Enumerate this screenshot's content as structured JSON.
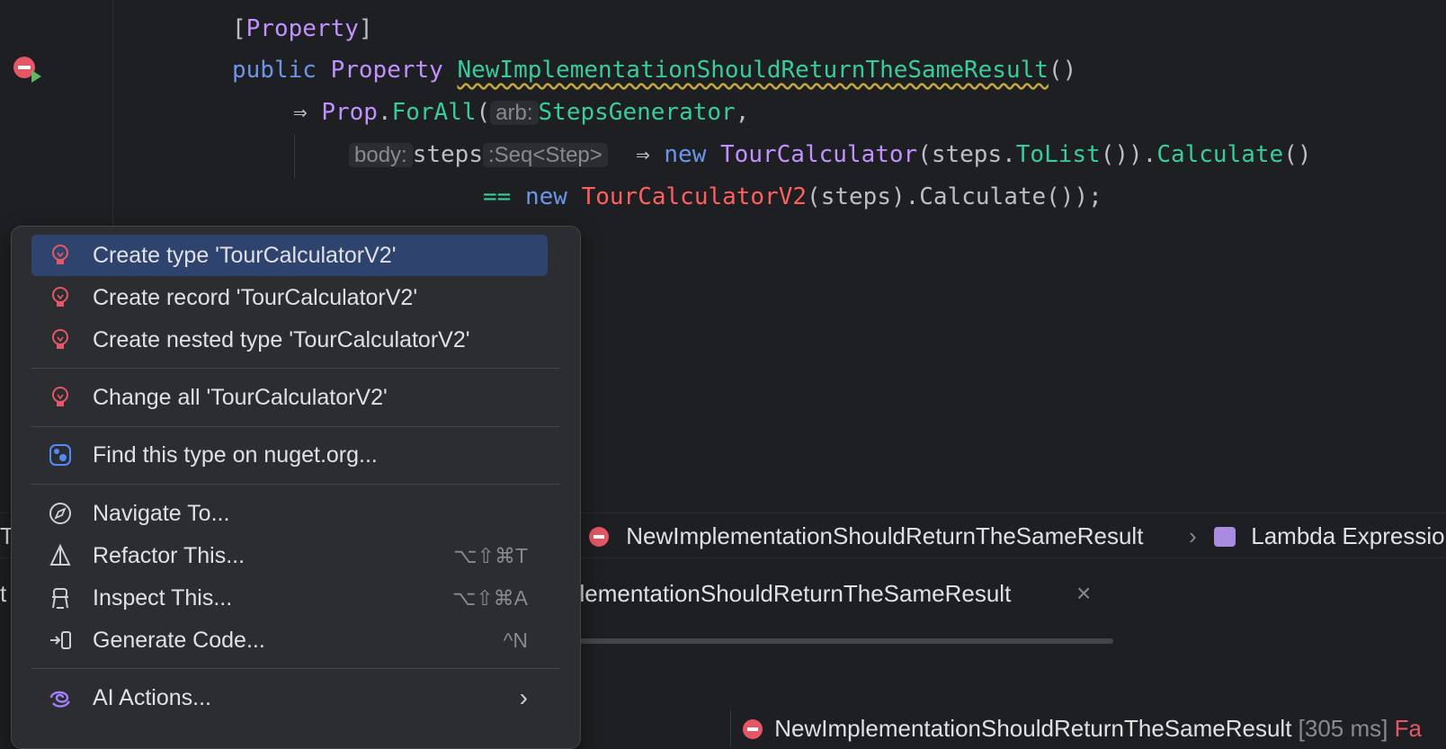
{
  "editor": {
    "line1": {
      "open": "[",
      "attr": "Property",
      "close": "]"
    },
    "line2": {
      "kw": "public",
      "type": "Property",
      "method": "NewImplementationShouldReturnTheSameResult",
      "parens": "()"
    },
    "line3": {
      "arrow": "⇒",
      "cls": "Prop",
      "dot": ".",
      "method": "ForAll",
      "paren": "(",
      "hint": "arb:",
      "gen": "StepsGenerator",
      "comma": ","
    },
    "line4": {
      "hint_body": "body:",
      "param": "steps",
      "hint_type": ":Seq<Step>",
      "arrow": "⇒",
      "kw": "new",
      "cls": "TourCalculator",
      "open": "(steps.",
      "tolist": "ToList",
      "mid": "()).",
      "calc": "Calculate",
      "close": "()"
    },
    "line5": {
      "op": "==",
      "kw": "new",
      "cls": "TourCalculatorV2",
      "rest": "(steps).Calculate());"
    }
  },
  "popup": {
    "items": [
      {
        "label": "Create type 'TourCalculatorV2'",
        "icon": "lightbulb-icon",
        "selected": true
      },
      {
        "label": "Create record 'TourCalculatorV2'",
        "icon": "lightbulb-icon"
      },
      {
        "label": "Create nested type 'TourCalculatorV2'",
        "icon": "lightbulb-icon"
      },
      {
        "label": "Change all 'TourCalculatorV2'",
        "icon": "lightbulb-icon"
      },
      {
        "label": "Find this type on nuget.org...",
        "icon": "nuget-icon"
      },
      {
        "label": "Navigate To...",
        "icon": "compass-icon"
      },
      {
        "label": "Refactor This...",
        "icon": "refactor-icon",
        "shortcut": "⌥⇧⌘T"
      },
      {
        "label": "Inspect This...",
        "icon": "inspect-icon",
        "shortcut": "⌥⇧⌘A"
      },
      {
        "label": "Generate Code...",
        "icon": "generate-icon",
        "shortcut": "^N"
      },
      {
        "label": "AI Actions...",
        "icon": "ai-icon",
        "submenu": "›"
      }
    ]
  },
  "navbar": {
    "method": "NewImplementationShouldReturnTheSameResult",
    "sep": "›",
    "lambda": "Lambda Expressio"
  },
  "tabbar": {
    "tab": "plementationShouldReturnTheSameResult",
    "close": "×"
  },
  "results": {
    "name": "NewImplementationShouldReturnTheSameResult",
    "time": "[305 ms]",
    "status": "Fa"
  },
  "fragments": {
    "a": "Ta",
    "b": "t"
  },
  "colors": {
    "keyword": "#6c95eb",
    "type": "#c191ff",
    "method": "#39cc9b",
    "error": "#ff5f5f",
    "selection": "#2e436e"
  }
}
